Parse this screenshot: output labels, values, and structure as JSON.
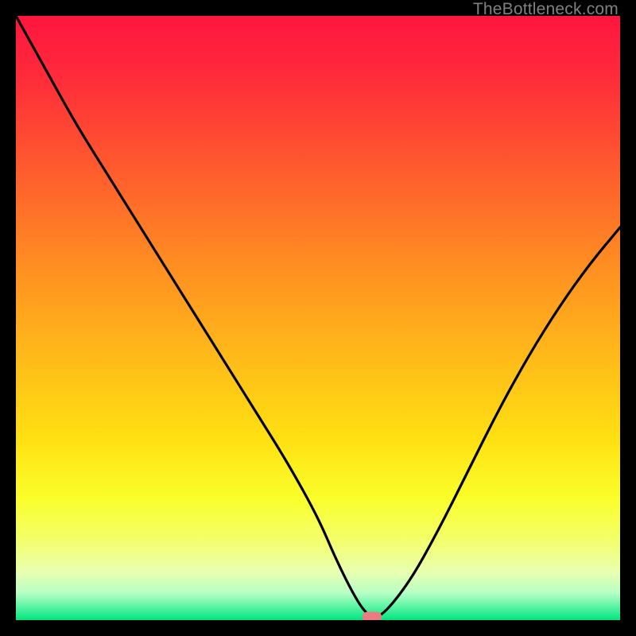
{
  "watermark": "TheBottleneck.com",
  "colors": {
    "black": "#000000",
    "marker": "#eb7c82",
    "curve": "#000000",
    "gradient_stops": [
      {
        "offset": 0.0,
        "color": "#ff153f"
      },
      {
        "offset": 0.1,
        "color": "#ff2b3a"
      },
      {
        "offset": 0.25,
        "color": "#ff5a2e"
      },
      {
        "offset": 0.4,
        "color": "#ff8a22"
      },
      {
        "offset": 0.55,
        "color": "#ffb61a"
      },
      {
        "offset": 0.7,
        "color": "#ffe012"
      },
      {
        "offset": 0.8,
        "color": "#faff2b"
      },
      {
        "offset": 0.87,
        "color": "#f3ff6e"
      },
      {
        "offset": 0.92,
        "color": "#e8ffb0"
      },
      {
        "offset": 0.955,
        "color": "#b8ffc4"
      },
      {
        "offset": 0.975,
        "color": "#66f6a8"
      },
      {
        "offset": 1.0,
        "color": "#00e57f"
      }
    ]
  },
  "chart_data": {
    "type": "line",
    "title": "",
    "xlabel": "",
    "ylabel": "",
    "xlim": [
      0,
      100
    ],
    "ylim": [
      0,
      100
    ],
    "series": [
      {
        "name": "bottleneck-curve",
        "x": [
          0,
          5,
          10,
          15,
          20,
          25,
          30,
          35,
          40,
          45,
          50,
          53,
          56,
          58,
          60,
          65,
          70,
          75,
          80,
          85,
          90,
          95,
          100
        ],
        "y": [
          100,
          91,
          82,
          74,
          66,
          58,
          50,
          42,
          34,
          26,
          17,
          10,
          4,
          1,
          0,
          6,
          15,
          25,
          35,
          44,
          52,
          59,
          65
        ]
      }
    ],
    "annotations": [
      {
        "name": "optimum-marker",
        "x": 59,
        "y": 0.5
      }
    ]
  }
}
